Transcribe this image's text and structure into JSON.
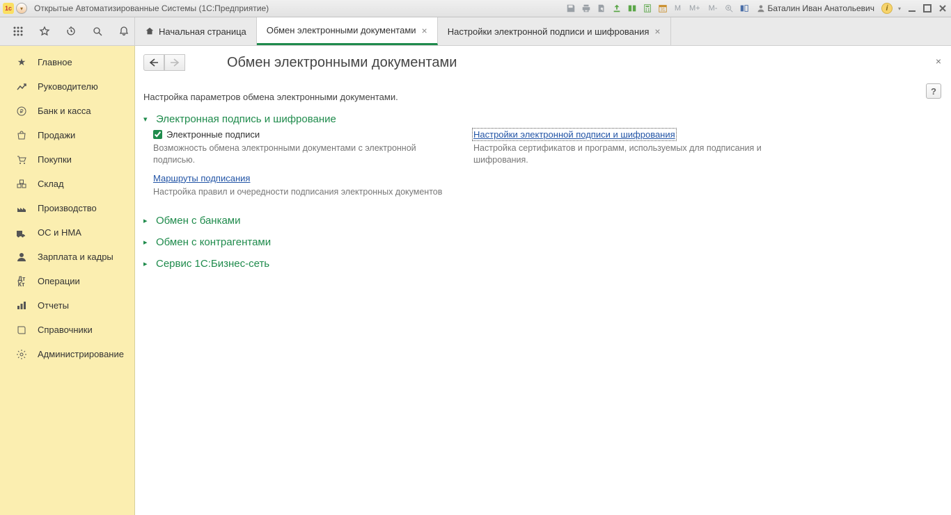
{
  "titlebar": {
    "title": "Открытые Автоматизированные Системы  (1С:Предприятие)",
    "user_name": "Баталин Иван Анатольевич",
    "m_labels": [
      "M",
      "M+",
      "M-"
    ]
  },
  "tabs": {
    "home": "Начальная страница",
    "active": "Обмен электронными документами",
    "third": "Настройки электронной подписи и шифрования"
  },
  "sidebar": {
    "items": [
      {
        "label": "Главное"
      },
      {
        "label": "Руководителю"
      },
      {
        "label": "Банк и касса"
      },
      {
        "label": "Продажи"
      },
      {
        "label": "Покупки"
      },
      {
        "label": "Склад"
      },
      {
        "label": "Производство"
      },
      {
        "label": "ОС и НМА"
      },
      {
        "label": "Зарплата и кадры"
      },
      {
        "label": "Операции"
      },
      {
        "label": "Отчеты"
      },
      {
        "label": "Справочники"
      },
      {
        "label": "Администрирование"
      }
    ]
  },
  "page": {
    "title": "Обмен электронными документами",
    "subtitle": "Настройка параметров обмена электронными документами.",
    "help": "?"
  },
  "sec1": {
    "title": "Электронная подпись и шифрование",
    "checkbox_label": "Электронные подписи",
    "checkbox_desc": "Возможность обмена электронными документами с электронной подписью.",
    "routes_link": "Маршруты подписания",
    "routes_desc": "Настройка правил и очередности подписания электронных документов",
    "settings_link": "Настройки электронной подписи и шифрования",
    "settings_desc": "Настройка сертификатов и программ, используемых для подписания и шифрования."
  },
  "sec2": {
    "title": "Обмен с банками"
  },
  "sec3": {
    "title": "Обмен с контрагентами"
  },
  "sec4": {
    "title": "Сервис 1С:Бизнес-сеть"
  }
}
